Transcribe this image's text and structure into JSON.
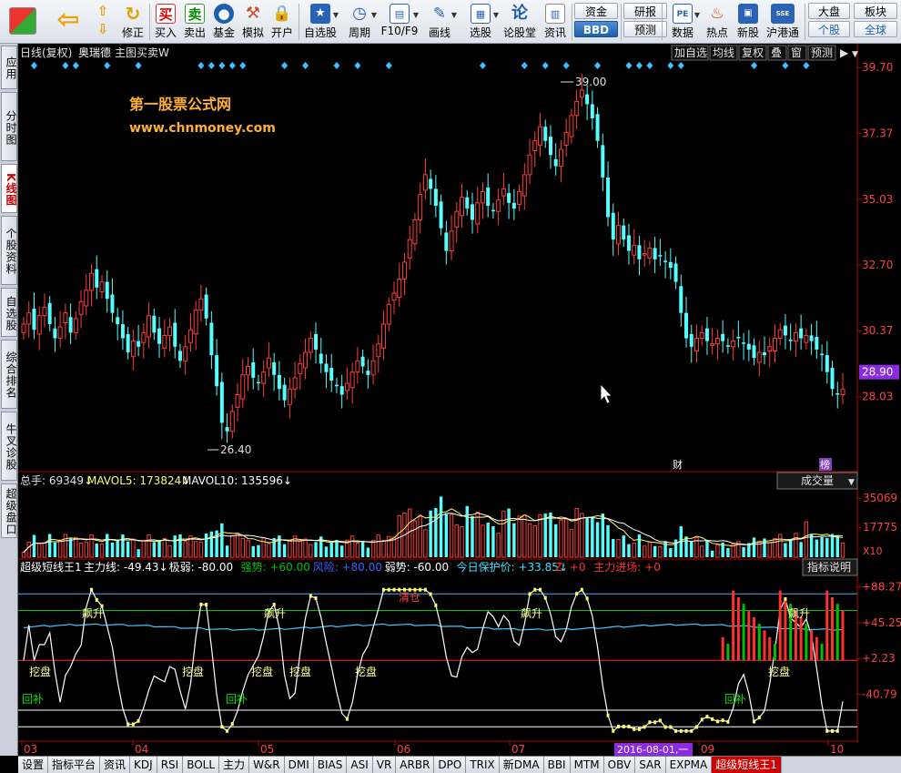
{
  "toolbar": {
    "buttons": [
      {
        "label": "修正",
        "icon": "refresh-icon"
      },
      {
        "label": "买入",
        "icon": "buy-icon"
      },
      {
        "label": "卖出",
        "icon": "sell-icon"
      },
      {
        "label": "基金",
        "icon": "fund-icon"
      },
      {
        "label": "模拟",
        "icon": "hammer-icon"
      },
      {
        "label": "开户",
        "icon": "lock-icon"
      },
      {
        "label": "自选股",
        "icon": "star-icon"
      },
      {
        "label": "周期",
        "icon": "clock-icon"
      },
      {
        "label": "F10/F9",
        "icon": "f10-icon"
      },
      {
        "label": "画线",
        "icon": "pen-icon"
      },
      {
        "label": "选股",
        "icon": "select-stock-icon"
      },
      {
        "label": "论股堂",
        "icon": "forum-icon"
      },
      {
        "label": "资讯",
        "icon": "news-icon"
      },
      {
        "label": "数据",
        "icon": "pe-icon"
      },
      {
        "label": "热点",
        "icon": "hot-icon"
      },
      {
        "label": "新股",
        "icon": "newstock-icon"
      },
      {
        "label": "沪港通",
        "icon": "sse-hkex-icon"
      }
    ],
    "buy_glyph": "买",
    "sell_glyph": "卖",
    "forum_glyph": "论",
    "pe_glyph": "PE",
    "sse_glyph": "SSE",
    "pair1": {
      "top": "资金",
      "bottom": "BBD"
    },
    "pair2": {
      "top": "研报",
      "bottom": "预测"
    },
    "pair3": {
      "top": "大盘",
      "bottom": "个股"
    },
    "pair4": {
      "top": "板块",
      "bottom": "全球"
    }
  },
  "left_tabs": [
    "应用",
    "分时图",
    "K线图",
    "个股资料",
    "自选股",
    "综合排名",
    "牛叉诊股",
    "超级盘口"
  ],
  "left_tab_active": 2,
  "chart_header": {
    "mode": "日线(复权)",
    "stock": "奥瑞德",
    "main_indicator": "主图买卖W",
    "buttons": [
      "加自选",
      "均线",
      "复权",
      "叠",
      "窗",
      "预测"
    ]
  },
  "watermark": {
    "line1": "第一股票公式网",
    "line2": "www.chnmoney.com"
  },
  "price_axis": [
    "39.70",
    "37.37",
    "35.03",
    "32.70",
    "30.37",
    "28.90",
    "28.03"
  ],
  "current_price": "28.90",
  "high_label": "39.00",
  "low_label": "26.40",
  "event_markers": [
    "财",
    "榜"
  ],
  "volume_header": {
    "total": "总手: 69349↓",
    "mavol5": "MAVOL5: 173824↓",
    "mavol10": "MAVOL10: 135596↓",
    "selector": "成交量"
  },
  "volume_axis": [
    "35069",
    "17775",
    "X10"
  ],
  "indicator_header": {
    "name": "超级短线王1",
    "items": [
      {
        "text": "主力线: -49.43↓",
        "color": "#ffffff"
      },
      {
        "text": "极弱: -80.00",
        "color": "#ffffff"
      },
      {
        "text": "强势: +60.00",
        "color": "#00c000"
      },
      {
        "text": "风险: +80.00",
        "color": "#4060ff"
      },
      {
        "text": "弱势: -60.00",
        "color": "#ffffff"
      },
      {
        "text": "今日保护价: +33.85↓",
        "color": "#40e0ff"
      },
      {
        "text": "Z: +0",
        "color": "#ff3030"
      },
      {
        "text": "主力进场: +0",
        "color": "#ff3030"
      }
    ],
    "help": "指标说明"
  },
  "indicator_axis": [
    "+88.27",
    "+45.25",
    "+2.23",
    "-40.79"
  ],
  "indicator_labels": {
    "rise": "飙升",
    "dig": "挖盘",
    "refill": "回补",
    "sell": "清仓"
  },
  "date_axis": [
    "03",
    "04",
    "05",
    "06",
    "07",
    "09",
    "10"
  ],
  "cursor_date": "2016-08-01,一",
  "bottom_tabs": [
    "设置",
    "指标平台",
    "资讯",
    "KDJ",
    "RSI",
    "BOLL",
    "主力",
    "W&R",
    "DMI",
    "BIAS",
    "ASI",
    "VR",
    "ARBR",
    "DPO",
    "TRIX",
    "新DMA",
    "BBI",
    "MTM",
    "OBV",
    "SAR",
    "EXPMA",
    "超级短线王1"
  ],
  "bottom_tab_active": 21,
  "colors": {
    "up": "#ff3c3c",
    "down": "#54ffff",
    "volume_up": "#ff3c3c",
    "volume_down": "#54ffff",
    "axis": "#c00000",
    "price_text": "#ff4040",
    "diamond": "#40c0ff",
    "ma_line": "#3cb0ff",
    "signal_yellow": "#ffff66"
  },
  "chart_data": {
    "type": "candlestick",
    "title": "奥瑞德 日线(复权)",
    "ylim": [
      25.5,
      39.9
    ],
    "price_ticks": [
      39.7,
      37.37,
      35.03,
      32.7,
      30.37,
      28.03
    ],
    "x": [
      "03",
      "04",
      "05",
      "06",
      "07",
      "09",
      "10"
    ],
    "high": 39.0,
    "low": 26.4,
    "last_close": 28.9,
    "close_path": [
      30.6,
      31.0,
      30.4,
      30.9,
      31.2,
      30.6,
      30.1,
      30.5,
      31.0,
      30.3,
      30.8,
      31.4,
      31.8,
      32.4,
      31.9,
      32.1,
      31.5,
      31.0,
      30.6,
      30.1,
      29.6,
      30.0,
      29.8,
      30.3,
      30.9,
      30.3,
      29.9,
      30.2,
      30.5,
      29.8,
      29.3,
      29.8,
      30.4,
      31.1,
      31.5,
      30.8,
      29.5,
      28.4,
      27.1,
      26.8,
      27.5,
      28.1,
      28.8,
      29.1,
      28.7,
      28.5,
      28.9,
      29.4,
      28.8,
      28.3,
      27.9,
      28.3,
      28.7,
      29.2,
      29.6,
      30.1,
      29.7,
      29.2,
      28.9,
      28.6,
      28.4,
      28.1,
      28.5,
      28.9,
      29.3,
      29.1,
      28.8,
      29.3,
      29.9,
      30.6,
      31.3,
      31.7,
      32.2,
      32.8,
      33.6,
      34.3,
      35.2,
      35.9,
      35.4,
      34.8,
      34.0,
      33.2,
      33.9,
      34.6,
      35.1,
      34.7,
      34.3,
      34.9,
      35.3,
      34.8,
      34.6,
      35.0,
      35.4,
      34.9,
      34.7,
      35.3,
      35.9,
      36.6,
      37.1,
      37.6,
      37.1,
      36.6,
      36.2,
      36.8,
      37.4,
      38.0,
      38.5,
      38.9,
      38.4,
      37.9,
      37.1,
      35.8,
      34.4,
      33.6,
      34.1,
      33.6,
      33.2,
      33.4,
      32.9,
      33.1,
      33.3,
      32.9,
      33.0,
      32.8,
      32.6,
      32.1,
      31.0,
      30.1,
      29.8,
      30.1,
      30.3,
      30.0,
      29.9,
      30.1,
      30.0,
      29.8,
      30.0,
      30.1,
      29.9,
      29.7,
      29.4,
      29.6,
      29.5,
      29.8,
      30.1,
      30.4,
      30.2,
      30.0,
      30.3,
      30.1,
      30.2,
      30.0,
      29.7,
      29.5,
      28.9,
      28.3,
      28.1,
      28.3
    ],
    "volume_ticks": [
      35069,
      17775
    ],
    "volume_unit": "X10",
    "indicator_ticks": [
      88.27,
      45.25,
      2.23,
      -40.79
    ],
    "indicator_levels": {
      "strong": 60,
      "risk": 80,
      "weak": -60,
      "extreme_weak": -80,
      "protect_price": 33.85
    },
    "main_line_last": -49.43
  }
}
